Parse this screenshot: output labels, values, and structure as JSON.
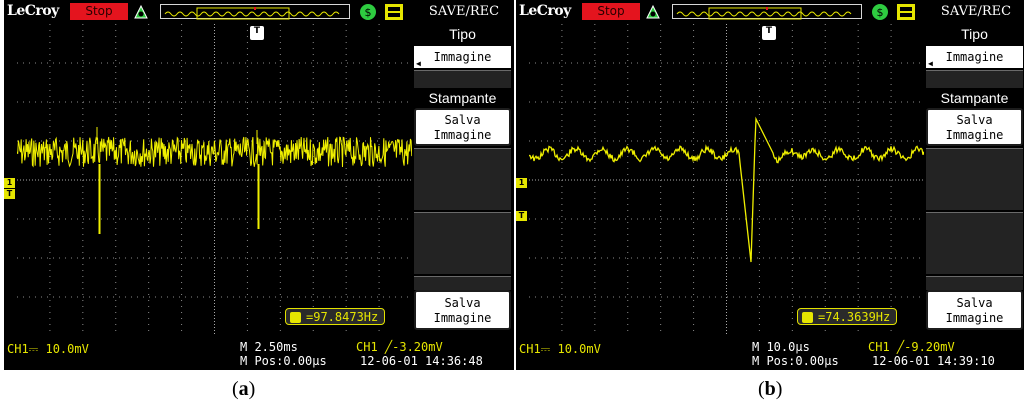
{
  "panels": [
    {
      "id": "a",
      "brand": "LeCroy",
      "run_state": "Stop",
      "menu_title": "SAVE/REC",
      "menu": {
        "type_label": "Tipo",
        "type_value": "Immagine",
        "printer_label": "Stampante",
        "save_image_1": [
          "Salva",
          "Immagine"
        ],
        "save_image_2": [
          "Salva",
          "Immagine"
        ]
      },
      "trigger_marker": "T",
      "ch1_marker": "1",
      "trig_level_marker": "T",
      "frequency": "=97.8473Hz",
      "status": {
        "channel": "CH1⎓ 10.0mV",
        "timebase": "M 2.50ms",
        "position": "M Pos:0.00μs",
        "trigger": "CH1 ╱-3.20mV",
        "datetime": "12-06-01 14:36:48"
      },
      "caption": "a"
    },
    {
      "id": "b",
      "brand": "LeCroy",
      "run_state": "Stop",
      "menu_title": "SAVE/REC",
      "menu": {
        "type_label": "Tipo",
        "type_value": "Immagine",
        "printer_label": "Stampante",
        "save_image_1": [
          "Salva",
          "Immagine"
        ],
        "save_image_2": [
          "Salva",
          "Immagine"
        ]
      },
      "trigger_marker": "T",
      "ch1_marker": "1",
      "trig_level_marker": "T",
      "frequency": "=74.3639Hz",
      "status": {
        "channel": "CH1⎓ 10.0mV",
        "timebase": "M 10.0μs",
        "position": "M Pos:0.00μs",
        "trigger": "CH1 ╱-9.20mV",
        "datetime": "12-06-01 14:39:10"
      },
      "caption": "b"
    }
  ],
  "colors": {
    "trace": "#f0f000",
    "screen": "#000000",
    "grid": "#8a8a8a",
    "stop_red": "#e4141e"
  }
}
